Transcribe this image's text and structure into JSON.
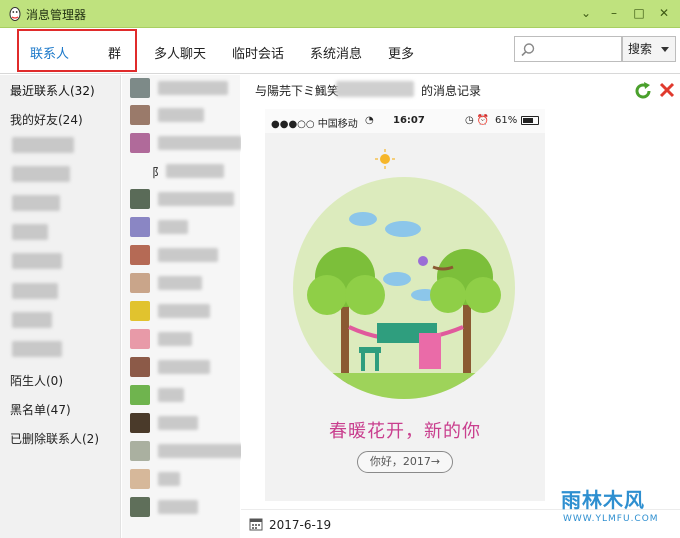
{
  "window": {
    "title": "消息管理器",
    "controls": [
      "chevron-down-icon",
      "minimize-icon",
      "maximize-icon",
      "close-icon"
    ]
  },
  "nav": {
    "tabs": [
      {
        "label": "联系人"
      },
      {
        "label": "群"
      },
      {
        "label": "多人聊天"
      },
      {
        "label": "临时会话"
      },
      {
        "label": "系统消息"
      },
      {
        "label": "更多"
      }
    ],
    "active_tab": "联系人",
    "search_placeholder": "",
    "search_button": "搜索"
  },
  "categories": {
    "recent": "最近联系人(32)",
    "friends": "我的好友(24)",
    "strangers": "陌生人(0)",
    "blacklist": "黑名单(47)",
    "deleted": "已删除联系人(2)"
  },
  "contact_list": {
    "partial_name_char": "阝"
  },
  "record": {
    "title_prefix": "与陽芫下ミ鯴笑",
    "title_suffix": "的消息记录",
    "date": "2017-6-19"
  },
  "phone": {
    "carrier": "●●●○○ 中国移动",
    "time": "16:07",
    "battery": "61%",
    "greeting": "春暖花开，新的你",
    "button": "你好，2017→"
  },
  "watermark": {
    "main": "雨林木风",
    "sub": "WWW.YLMFU.COM"
  },
  "colors": {
    "titlebar": "#bfe27e",
    "accent_blue": "#1b78c9",
    "highlight_red": "#e02b2b",
    "greeting_pink": "#c93f8e"
  }
}
